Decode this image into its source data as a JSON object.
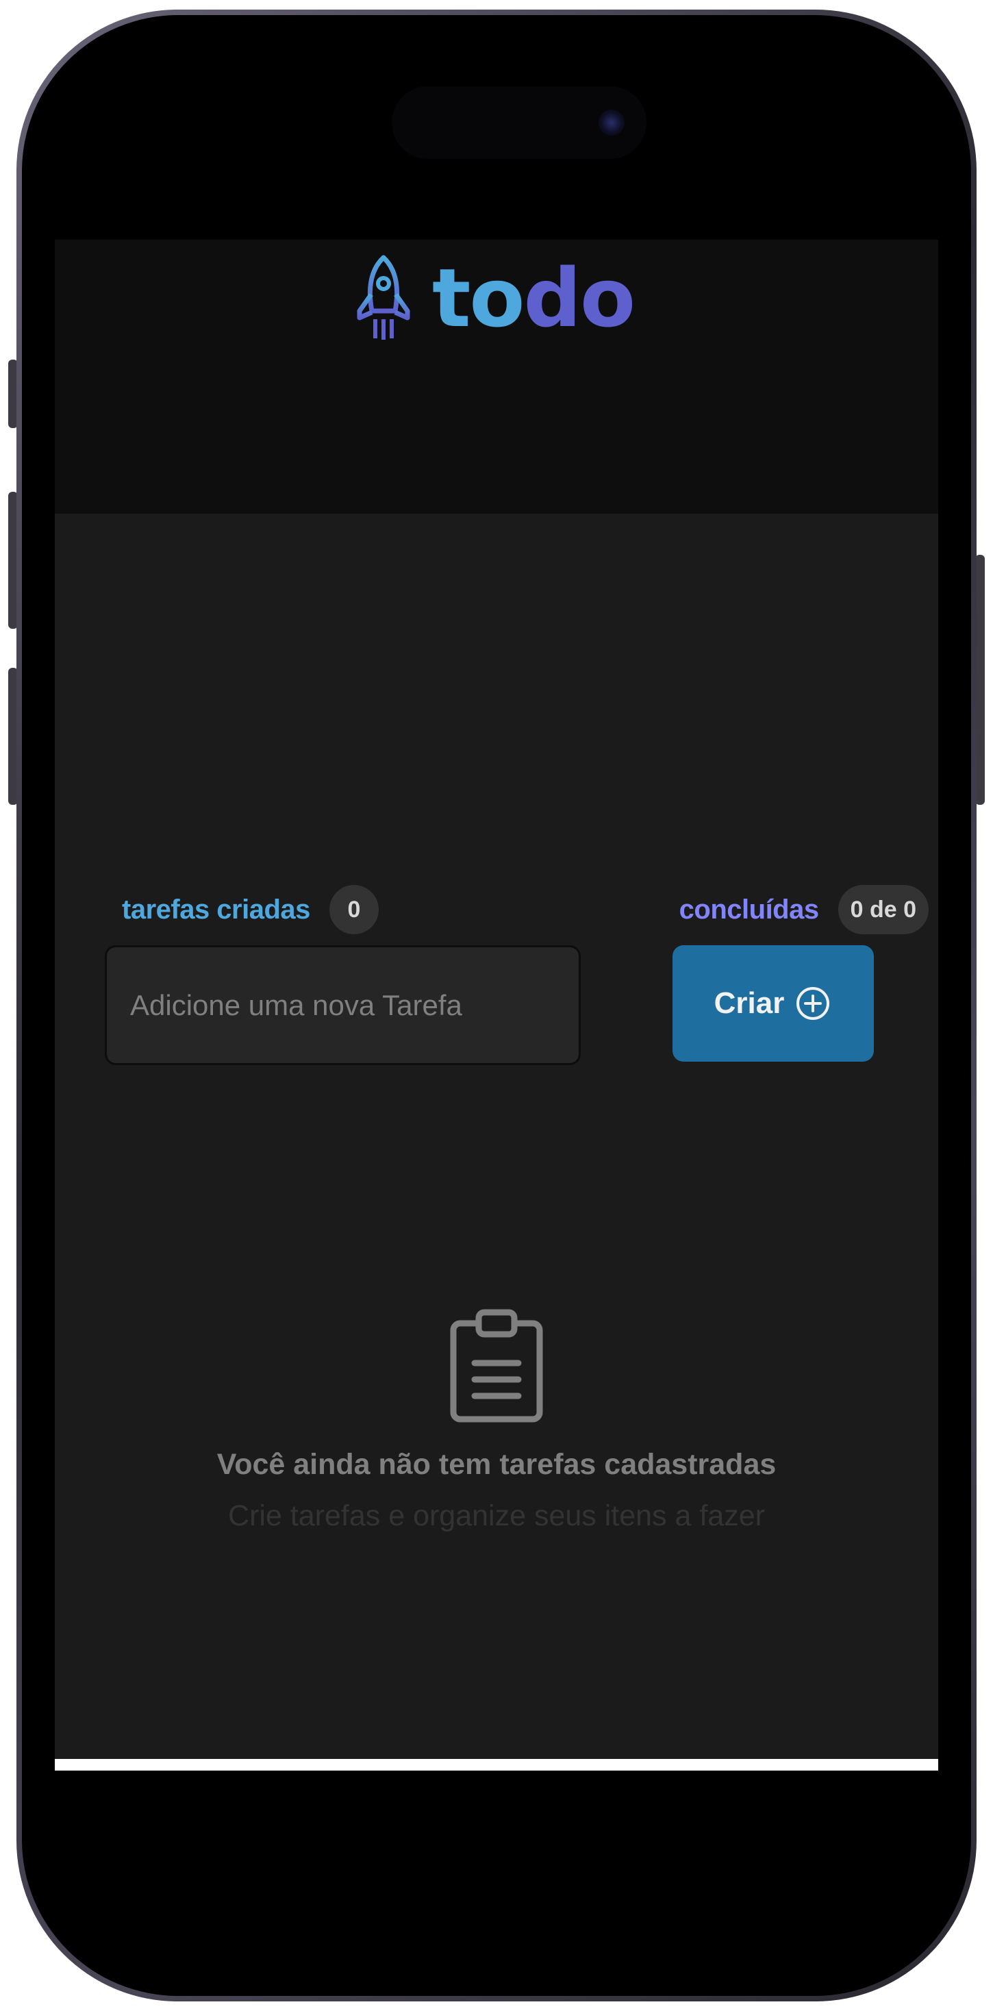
{
  "app": {
    "logo": {
      "icon": "rocket-icon",
      "text_part1": "to",
      "text_part2": "do"
    }
  },
  "counters": {
    "created_label": "tarefas criadas",
    "created_value": "0",
    "done_label": "concluídas",
    "done_value": "0 de 0"
  },
  "form": {
    "input_placeholder": "Adicione uma nova Tarefa",
    "input_value": "",
    "create_button_label": "Criar",
    "create_button_icon": "plus-circle-icon"
  },
  "empty_state": {
    "icon": "clipboard-icon",
    "title": "Você ainda não tem tarefas cadastradas",
    "subtitle": "Crie tarefas e organize seus itens a fazer"
  },
  "colors": {
    "blue": "#4ea8de",
    "purple": "#5e60ce",
    "purple_light": "#8284fa",
    "button": "#1e6f9f",
    "background": "#1b1b1b",
    "header": "#0e0e0e"
  }
}
